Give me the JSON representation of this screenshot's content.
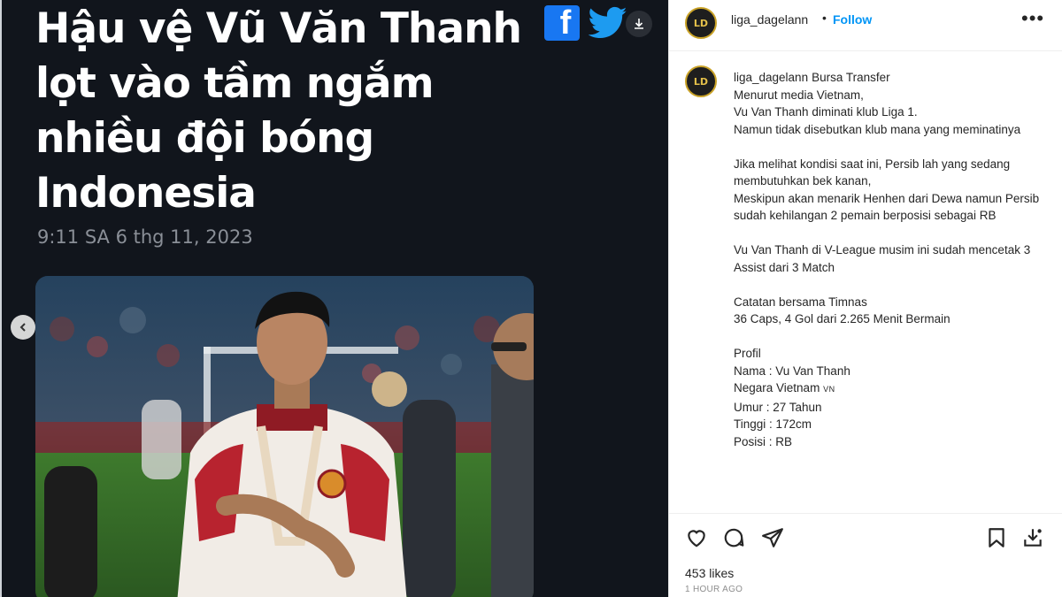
{
  "post_image": {
    "headline": "Hậu vệ Vũ Văn Thanh lọt vào tầm ngắm nhiều đội bóng Indonesia",
    "timestamp": "9:11 SA 6 thg 11, 2023",
    "share_icons": [
      "facebook-icon",
      "twitter-icon"
    ],
    "download_icon": "download-icon",
    "prev_icon": "chevron-left-icon"
  },
  "header": {
    "username": "liga_dagelann",
    "separator": "•",
    "follow_label": "Follow",
    "more_icon": "more-icon",
    "avatar_text": "LD"
  },
  "caption": {
    "username": "liga_dagelann",
    "paragraphs": [
      "Bursa Transfer\nMenurut media Vietnam,\nVu Van Thanh diminati klub Liga 1.\nNamun tidak disebutkan klub mana yang meminatinya",
      "Jika melihat kondisi saat ini, Persib lah yang sedang membutuhkan bek kanan,\nMeskipun akan menarik Henhen dari Dewa namun Persib sudah kehilangan 2 pemain berposisi sebagai RB",
      "Vu Van Thanh di V-League musim ini sudah mencetak 3 Assist dari 3 Match",
      "Catatan bersama Timnas\n36 Caps, 4 Gol dari 2.265 Menit Bermain"
    ],
    "profile_lines": [
      "Profil",
      "Nama : Vu Van Thanh",
      "Negara Vietnam",
      "Umur : 27 Tahun",
      "Tinggi : 172cm",
      "Posisi : RB"
    ],
    "flag_text": "VN"
  },
  "actions": {
    "icons": [
      "heart-icon",
      "comment-icon",
      "share-icon",
      "bookmark-icon",
      "save-download-icon"
    ],
    "likes": "453 likes",
    "time_ago": "1 HOUR AGO"
  },
  "colors": {
    "follow": "#0095f6",
    "facebook": "#1877f2",
    "twitter": "#1d9bf0",
    "media_bg": "#11151c"
  }
}
